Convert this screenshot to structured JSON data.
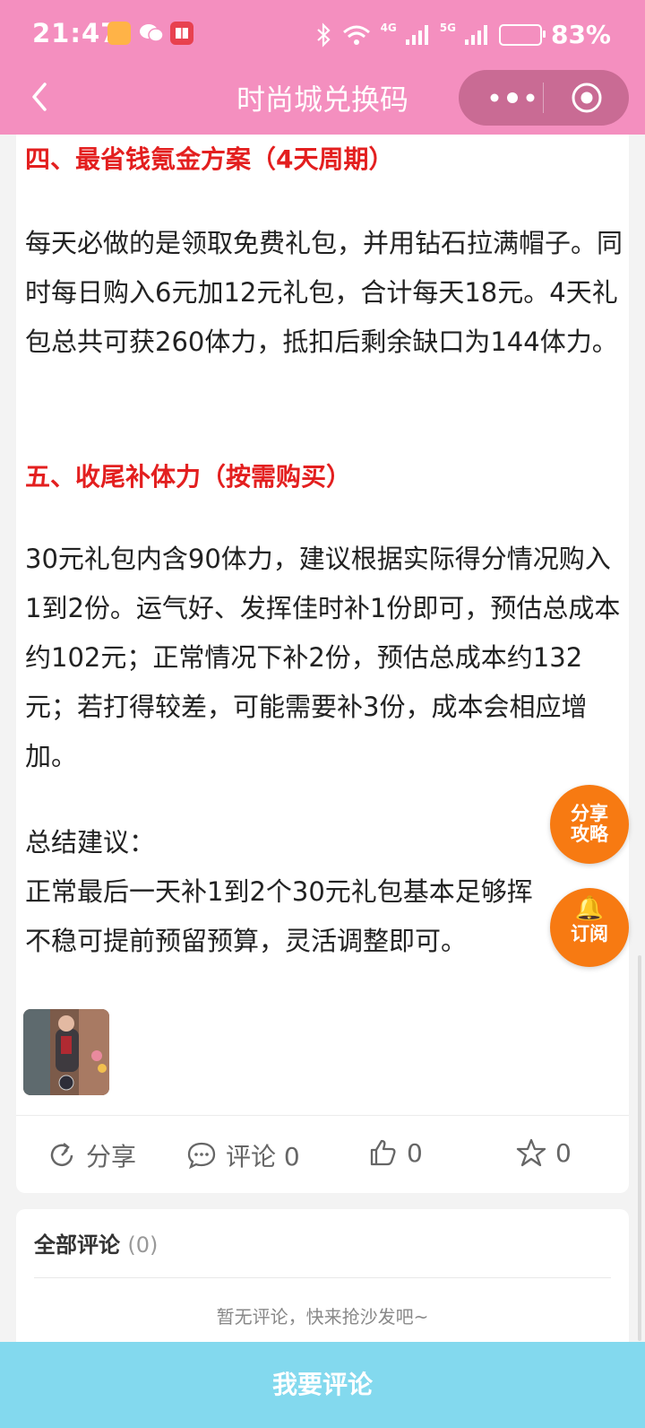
{
  "status_bar": {
    "time": "21:47",
    "network_1": "4G",
    "network_2": "5G",
    "battery": "83%"
  },
  "nav": {
    "title": "时尚城兑换码"
  },
  "article": {
    "heading_4": "四、最省钱氪金方案（4天周期）",
    "para_4": "每天必做的是领取免费礼包，并用钻石拉满帽子。同时每日购入6元加12元礼包，合计每天18元。4天礼包总共可获260体力，抵扣后剩余缺口为144体力。",
    "heading_5": "五、收尾补体力（按需购买）",
    "para_5": "30元礼包内含90体力，建议根据实际得分情况购入1到2份。运气好、发挥佳时补1份即可，预估总成本约102元；正常情况下补2份，预估总成本约132元；若打得较差，可能需要补3份，成本会相应增加。",
    "summary_title": "总结建议：",
    "summary_text": "正常最后一天补1到2个30元礼包基本足够挥不稳可提前预留预算，灵活调整即可。"
  },
  "actions": {
    "share_label": "分享",
    "comment_label": "评论 0",
    "like_count": "0",
    "fav_count": "0"
  },
  "floating": {
    "share_guide_line1": "分享",
    "share_guide_line2": "攻略",
    "subscribe_label": "订阅"
  },
  "comments": {
    "title": "全部评论",
    "count": "(0)",
    "empty_text": "暂无评论，快来抢沙发吧~"
  },
  "bottom_button": "我要评论",
  "colors": {
    "header_pink": "#f48fbf",
    "heading_red": "#e31f1f",
    "float_orange": "#f77a12",
    "bottom_cyan": "#83d9ee"
  }
}
